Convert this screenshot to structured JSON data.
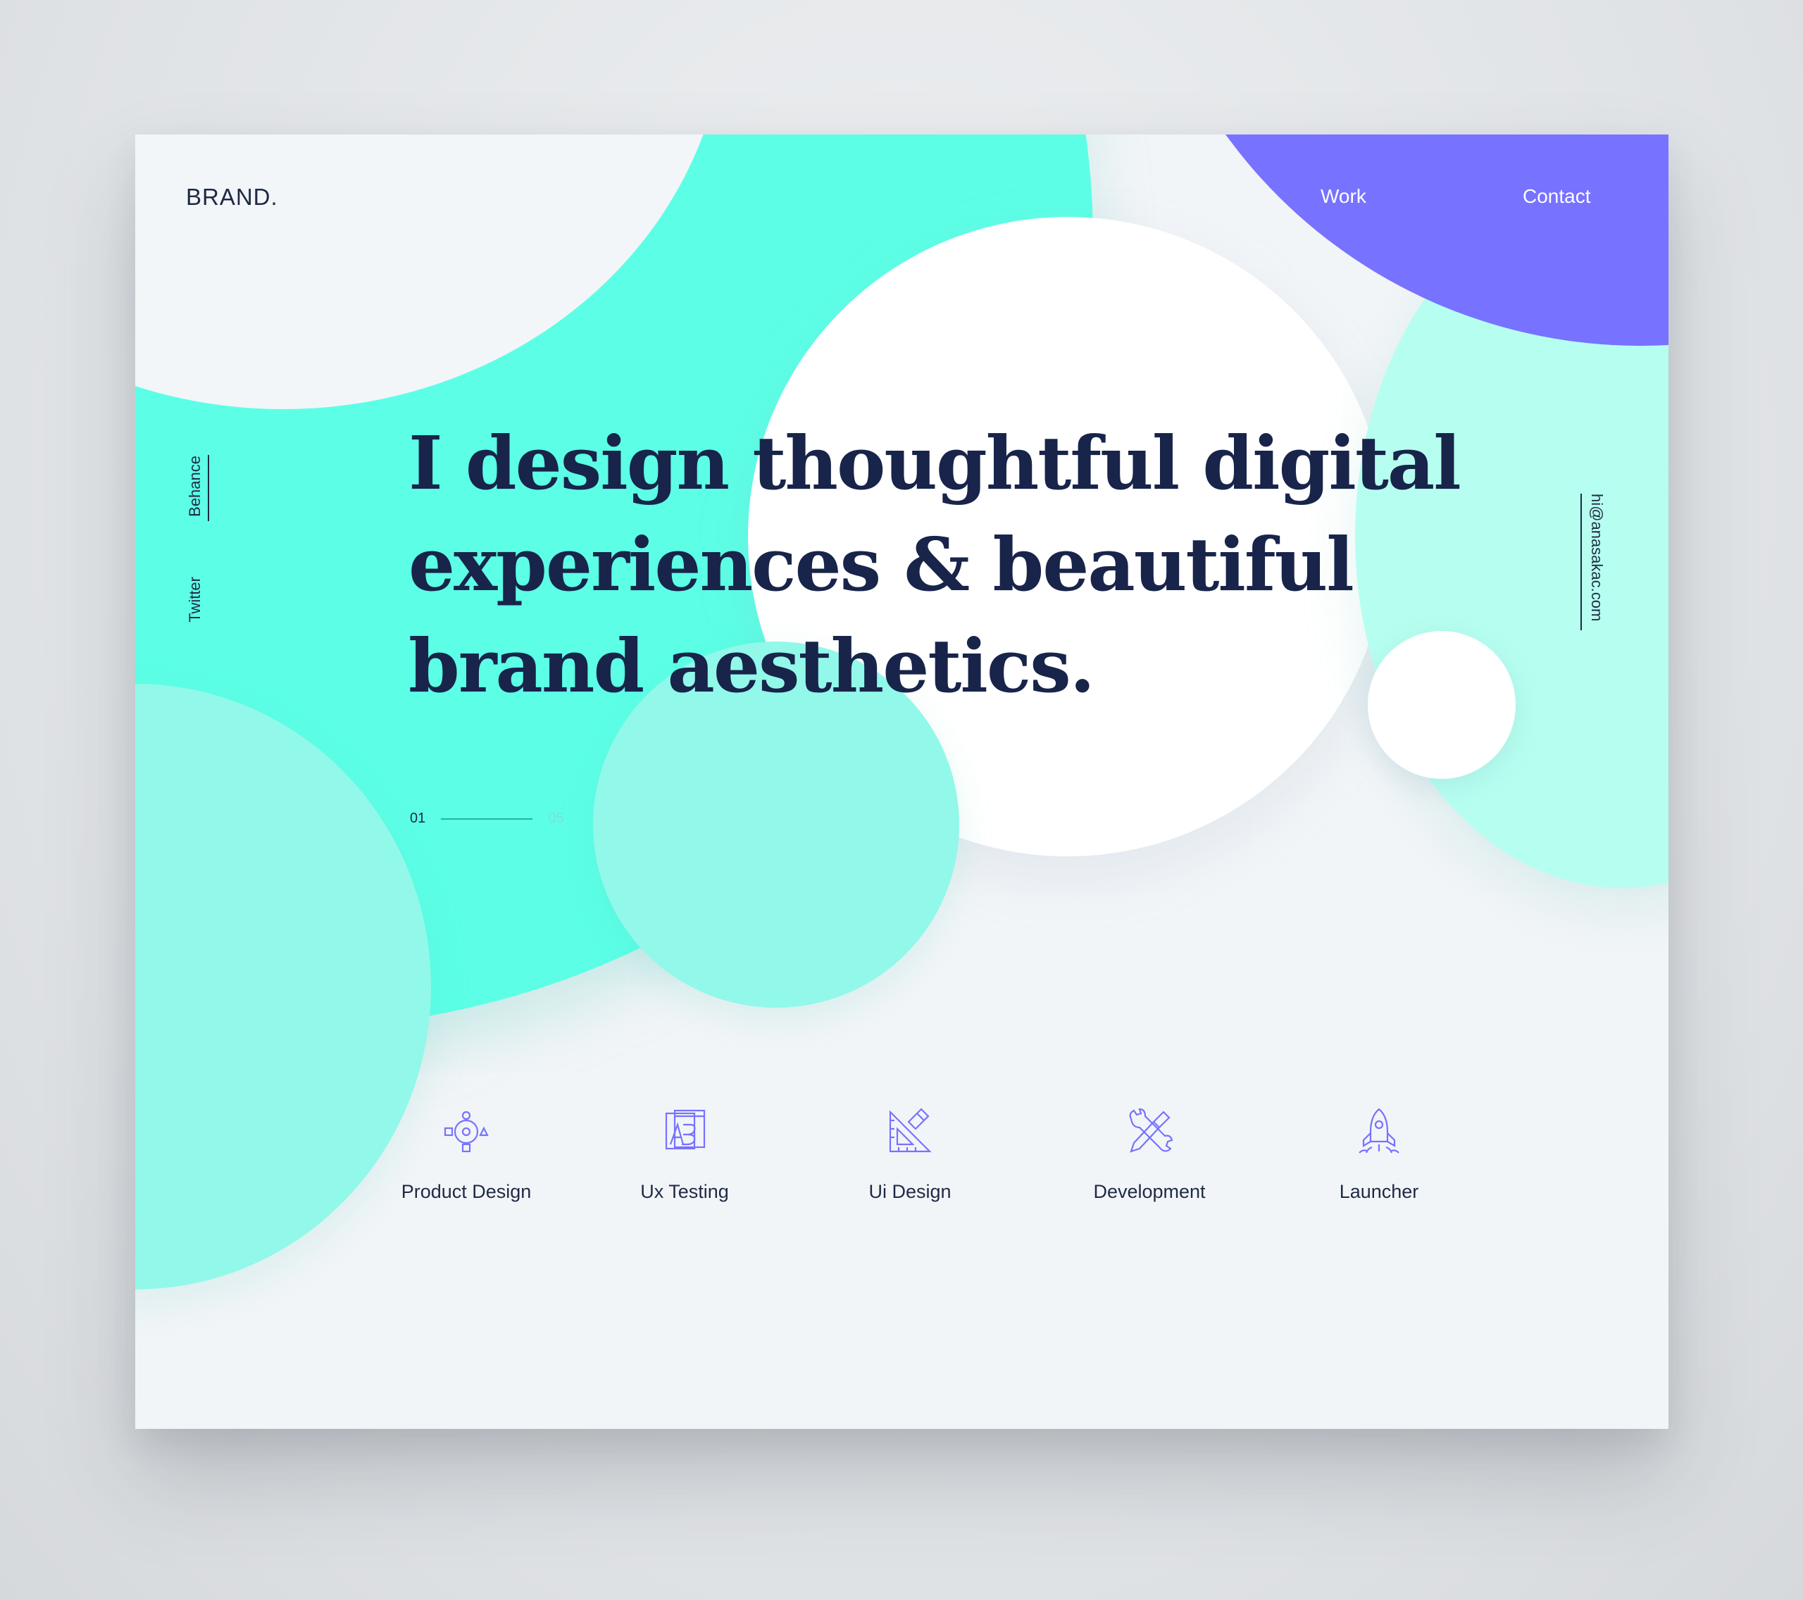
{
  "brand": {
    "name": "BRAND."
  },
  "nav": {
    "items": [
      {
        "label": "Work"
      },
      {
        "label": "Contact"
      }
    ]
  },
  "social": {
    "behance": "Behance",
    "twitter": "Twitter"
  },
  "contact": {
    "email": "hi@anasakac.com"
  },
  "hero": {
    "headline": "I design thoughtful digital experiences & beautiful brand aesthetics."
  },
  "slider": {
    "current": "01",
    "total": "05"
  },
  "services": [
    {
      "label": "Product Design",
      "icon": "product-design-icon"
    },
    {
      "label": "Ux Testing",
      "icon": "ux-testing-icon"
    },
    {
      "label": "Ui Design",
      "icon": "ui-design-icon"
    },
    {
      "label": "Development",
      "icon": "development-icon"
    },
    {
      "label": "Launcher",
      "icon": "launcher-icon"
    }
  ],
  "colors": {
    "teal": "#5cffe6",
    "mint": "#b6fff0",
    "purple": "#7772ff",
    "text": "#18244a",
    "icon": "#7772ff"
  }
}
